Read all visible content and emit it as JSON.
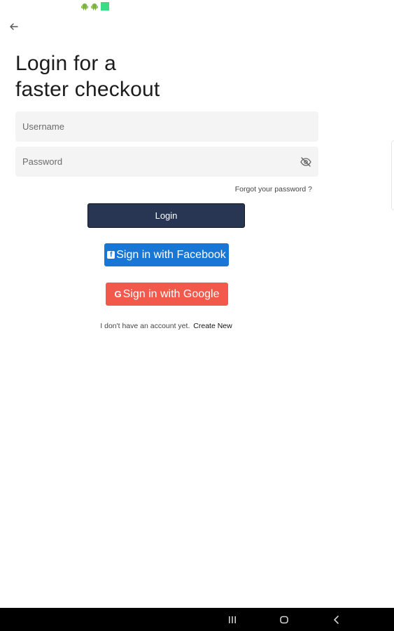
{
  "status_bar": {
    "icons": [
      "android-icon",
      "android-icon",
      "square-icon"
    ]
  },
  "header": {
    "back_icon": "arrow-left-icon"
  },
  "page": {
    "title": "Login for a\nfaster checkout"
  },
  "form": {
    "username": {
      "placeholder": "Username",
      "value": ""
    },
    "password": {
      "placeholder": "Password",
      "value": "",
      "toggle_icon": "eye-off-icon"
    },
    "forgot_label": "Forgot your password ?",
    "login_label": "Login"
  },
  "social": {
    "facebook_label": "Sign in with Facebook",
    "facebook_icon": "facebook-icon",
    "google_label": "Sign in with Google",
    "google_icon_glyph": "G"
  },
  "signup": {
    "prompt": "I don't have an account yet.",
    "link_label": "Create New"
  },
  "colors": {
    "login_button": "#283553",
    "facebook_button": "#1877d4",
    "google_button": "#f2594b",
    "field_background": "#f4f4f4",
    "status_icon_green": "#3ddc84"
  },
  "navigation_bar": {
    "icons": [
      "recent-apps-icon",
      "home-icon",
      "back-icon"
    ]
  }
}
